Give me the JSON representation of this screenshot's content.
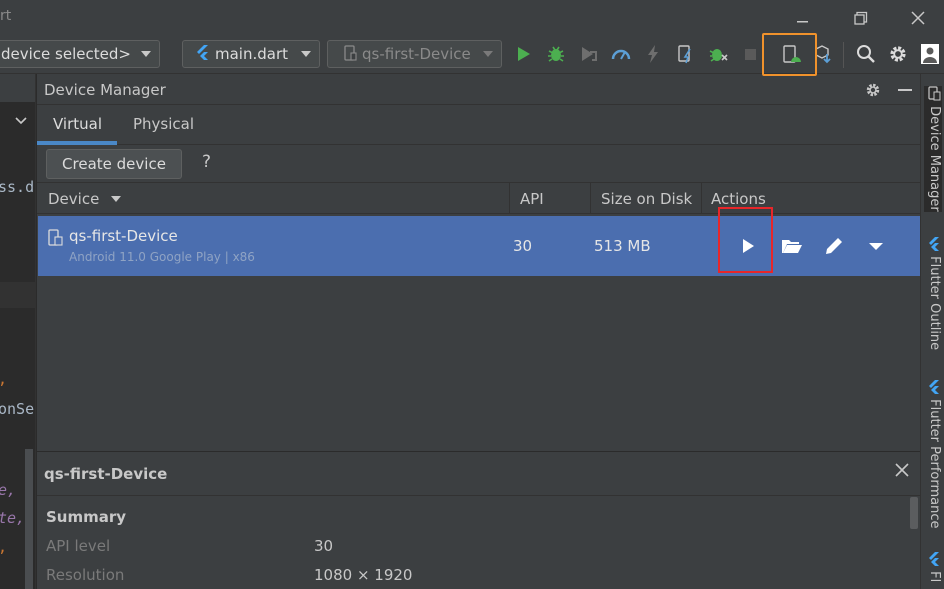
{
  "window": {
    "title": "rt"
  },
  "toolbar": {
    "device_selector": "device selected>",
    "run_config": "main.dart",
    "target_device": "qs-first-Device"
  },
  "editor_fragments": [
    "ss.d",
    ",",
    "onSe",
    "e,",
    "te,",
    ","
  ],
  "device_manager": {
    "title": "Device Manager",
    "tabs": [
      "Virtual",
      "Physical"
    ],
    "create_button": "Create device",
    "help": "?",
    "columns": [
      "Device",
      "API",
      "Size on Disk",
      "Actions"
    ],
    "devices": [
      {
        "name": "qs-first-Device",
        "subtitle": "Android 11.0 Google Play | x86",
        "api": "30",
        "size": "513 MB"
      }
    ],
    "details": {
      "title": "qs-first-Device",
      "section": "Summary",
      "rows": [
        {
          "label": "API level",
          "value": "30"
        },
        {
          "label": "Resolution",
          "value": "1080 × 1920"
        }
      ]
    }
  },
  "side_tabs": [
    "Device Manager",
    "Flutter Outline",
    "Flutter Performance",
    "Fl"
  ],
  "colors": {
    "accent": "#4b6eaf",
    "highlight_orange": "#f0922c",
    "highlight_red": "#e8262a",
    "run_green": "#4caf50"
  }
}
